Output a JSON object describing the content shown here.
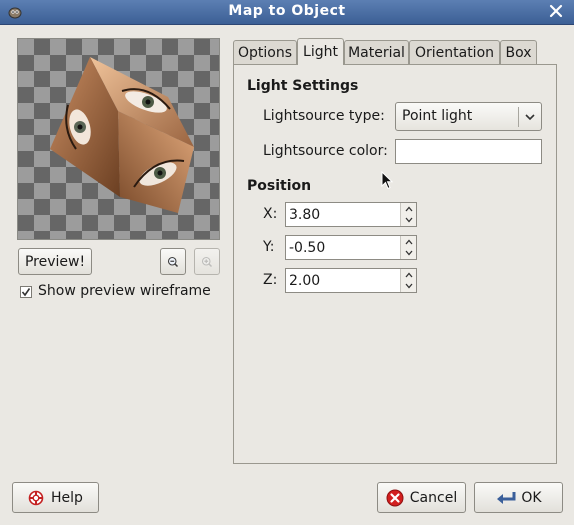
{
  "window": {
    "title": "Map to Object"
  },
  "preview": {
    "preview_button": "Preview!",
    "show_wireframe_label": "Show preview wireframe",
    "show_wireframe_checked": true
  },
  "tabs": [
    {
      "label": "Options",
      "active": false
    },
    {
      "label": "Light",
      "active": true
    },
    {
      "label": "Material",
      "active": false
    },
    {
      "label": "Orientation",
      "active": false
    },
    {
      "label": "Box",
      "active": false
    }
  ],
  "light_settings": {
    "heading": "Light Settings",
    "type_label": "Lightsource type:",
    "type_value": "Point light",
    "color_label": "Lightsource color:",
    "color_value": "#ffffff"
  },
  "position": {
    "heading": "Position",
    "x_label": "X:",
    "x_value": "3.80",
    "y_label": "Y:",
    "y_value": "-0.50",
    "z_label": "Z:",
    "z_value": "2.00"
  },
  "buttons": {
    "help": "Help",
    "cancel": "Cancel",
    "ok": "OK"
  },
  "colors": {
    "titlebar": "#4a6ea5",
    "cancel_icon": "#d21f1f",
    "dialog_bg": "#eae8e3"
  }
}
